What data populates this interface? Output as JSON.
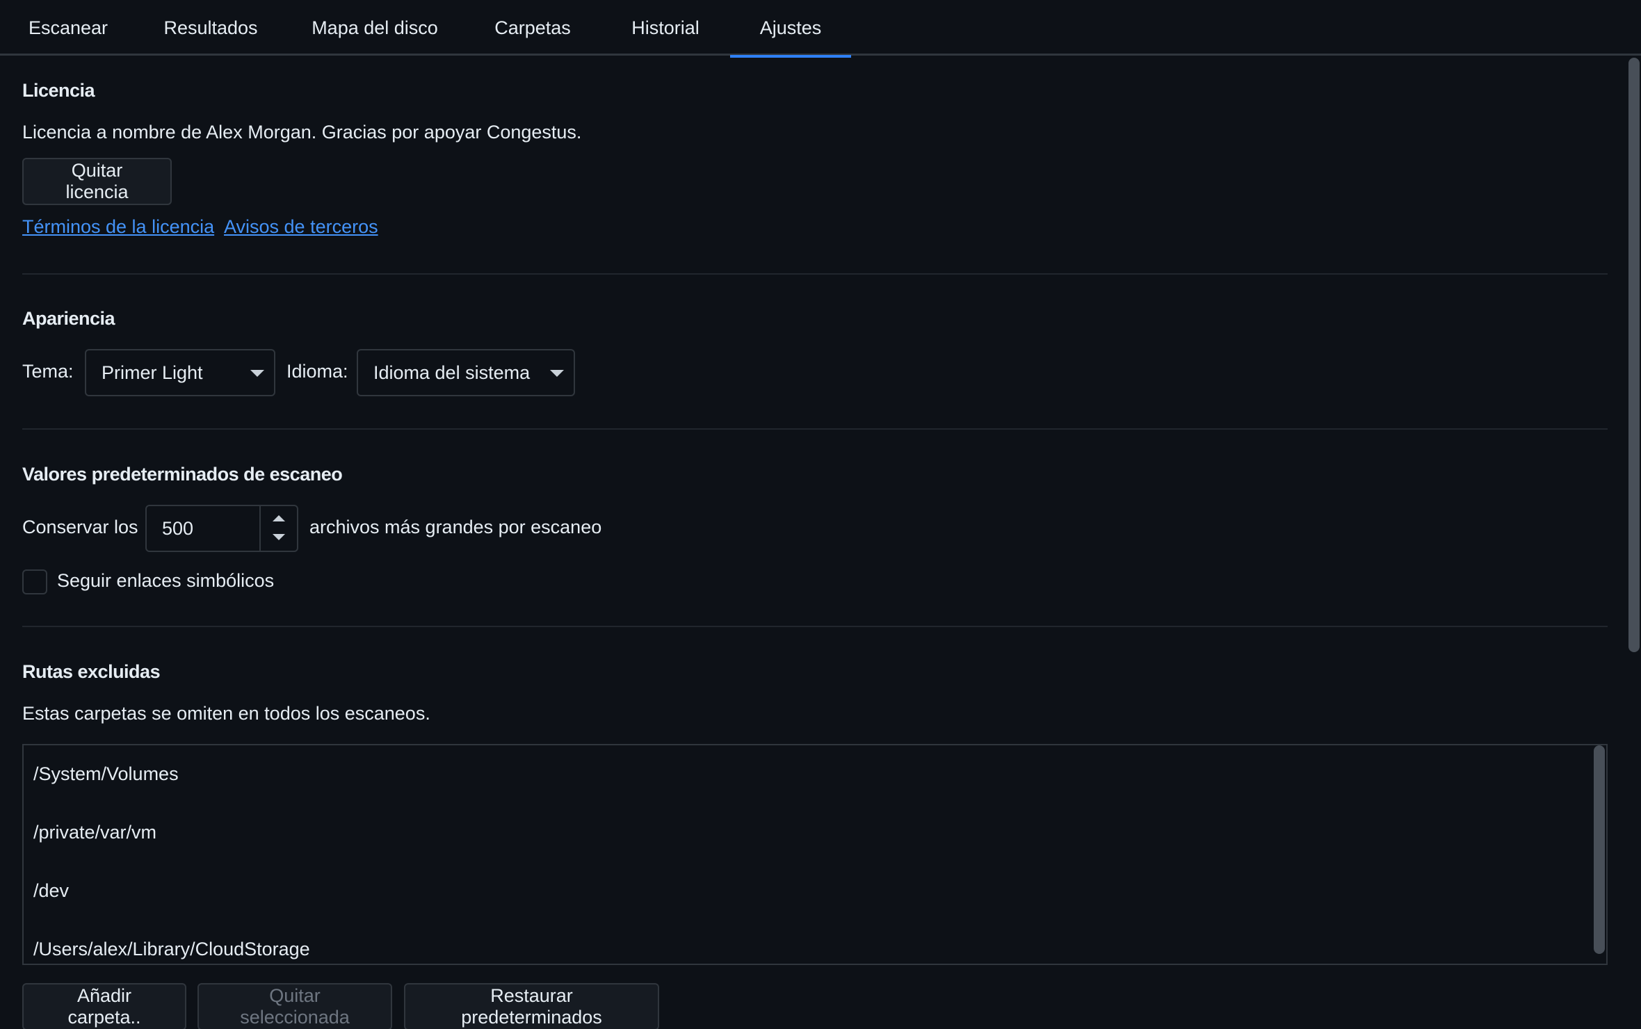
{
  "tabs": [
    {
      "label": "Escanear"
    },
    {
      "label": "Resultados"
    },
    {
      "label": "Mapa del disco"
    },
    {
      "label": "Carpetas"
    },
    {
      "label": "Historial"
    },
    {
      "label": "Ajustes",
      "active": true
    }
  ],
  "license": {
    "title": "Licencia",
    "message": "Licencia a nombre de Alex Morgan. Gracias por apoyar Congestus.",
    "remove_button": "Quitar licencia",
    "terms_link": "Términos de la licencia",
    "notices_link": "Avisos de terceros"
  },
  "appearance": {
    "title": "Apariencia",
    "theme_label": "Tema:",
    "theme_value": "Primer Light",
    "language_label": "Idioma:",
    "language_value": "Idioma del sistema"
  },
  "scan_defaults": {
    "title": "Valores predeterminados de escaneo",
    "keep_prefix": "Conservar los",
    "keep_value": "500",
    "keep_suffix": "archivos más grandes por escaneo",
    "follow_symlinks_label": "Seguir enlaces simbólicos",
    "follow_symlinks_checked": false
  },
  "excluded": {
    "title": "Rutas excluidas",
    "description": "Estas carpetas se omiten en todos los escaneos.",
    "paths": [
      "/System/Volumes",
      "/private/var/vm",
      "/dev",
      "/Users/alex/Library/CloudStorage"
    ],
    "add_button": "Añadir carpeta..",
    "remove_button": "Quitar seleccionada",
    "restore_button": "Restaurar predeterminados"
  },
  "colors": {
    "background": "#0d1117",
    "accent": "#2f81f7",
    "link": "#4493f8",
    "border": "#30363d"
  }
}
